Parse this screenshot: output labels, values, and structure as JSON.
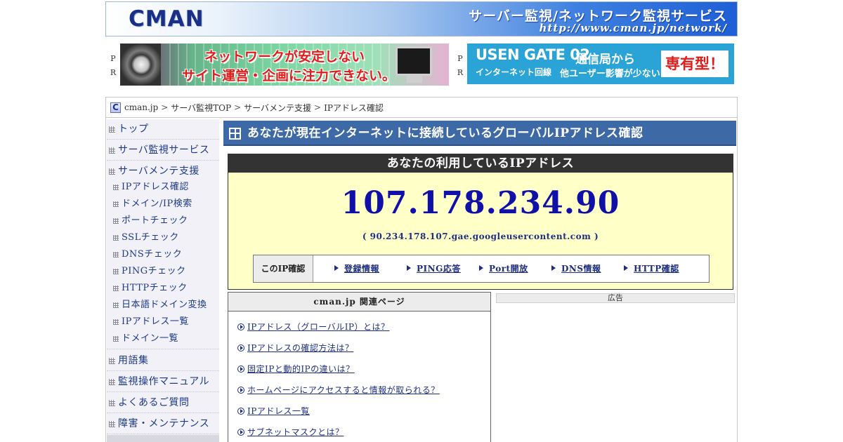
{
  "header": {
    "logo": "CMAN",
    "title": "サーバー監視/ネットワーク監視サービス",
    "url": "http://www.cman.jp/network/"
  },
  "ads": {
    "pr_label_1": "P",
    "pr_label_2": "R",
    "banner1": {
      "line1": "ネットワークが安定しない",
      "line2": "サイト運営・企画に注力できない。"
    },
    "banner2": {
      "brand": "USEN GATE 02",
      "sub": "インターネット回線",
      "line1": "通信局から",
      "line2": "他ユーザー影響が少ない",
      "badge": "専有型！"
    }
  },
  "breadcrumb": {
    "icon": "C",
    "items": [
      "cman.jp",
      "サーバ監視TOP",
      "サーバメンテ支援",
      "IPアドレス確認"
    ],
    "separator": ">"
  },
  "sidebar": {
    "items": [
      {
        "label": "トップ"
      },
      {
        "label": "サーバ監視サービス"
      },
      {
        "label": "サーバメンテ支援"
      }
    ],
    "subitems": [
      {
        "label": "IPアドレス確認"
      },
      {
        "label": "ドメイン/IP検索"
      },
      {
        "label": "ポートチェック"
      },
      {
        "label": "SSLチェック"
      },
      {
        "label": "DNSチェック"
      },
      {
        "label": "PINGチェック"
      },
      {
        "label": "HTTPチェック"
      },
      {
        "label": "日本語ドメイン変換"
      },
      {
        "label": "IPアドレス一覧"
      },
      {
        "label": "ドメイン一覧"
      }
    ],
    "items_bottom": [
      {
        "label": "用語集"
      },
      {
        "label": "監視操作マニュアル"
      },
      {
        "label": "よくあるご質問"
      },
      {
        "label": "障害・メンテナンス"
      }
    ]
  },
  "content": {
    "title": "あなたが現在インターネットに接続しているグローバルIPアドレス確認",
    "ip_box": {
      "heading": "あなたの利用しているIPアドレス",
      "ip": "107.178.234.90",
      "host": "( 90.234.178.107.gae.googleusercontent.com )",
      "actions_label": "このIP確認",
      "actions": [
        "登録情報",
        "PING応答",
        "Port開放",
        "DNS情報",
        "HTTP確認"
      ]
    },
    "related": {
      "heading": "cman.jp 関連ページ",
      "links": [
        "IPアドレス（グローバルIP）とは？",
        "IPアドレスの確認方法は？",
        "固定IPと動的IPの違いは？",
        "ホームページにアクセスすると情報が取られる？",
        "IPアドレス一覧",
        "サブネットマスクとは？"
      ]
    },
    "ad_label": "広告"
  }
}
